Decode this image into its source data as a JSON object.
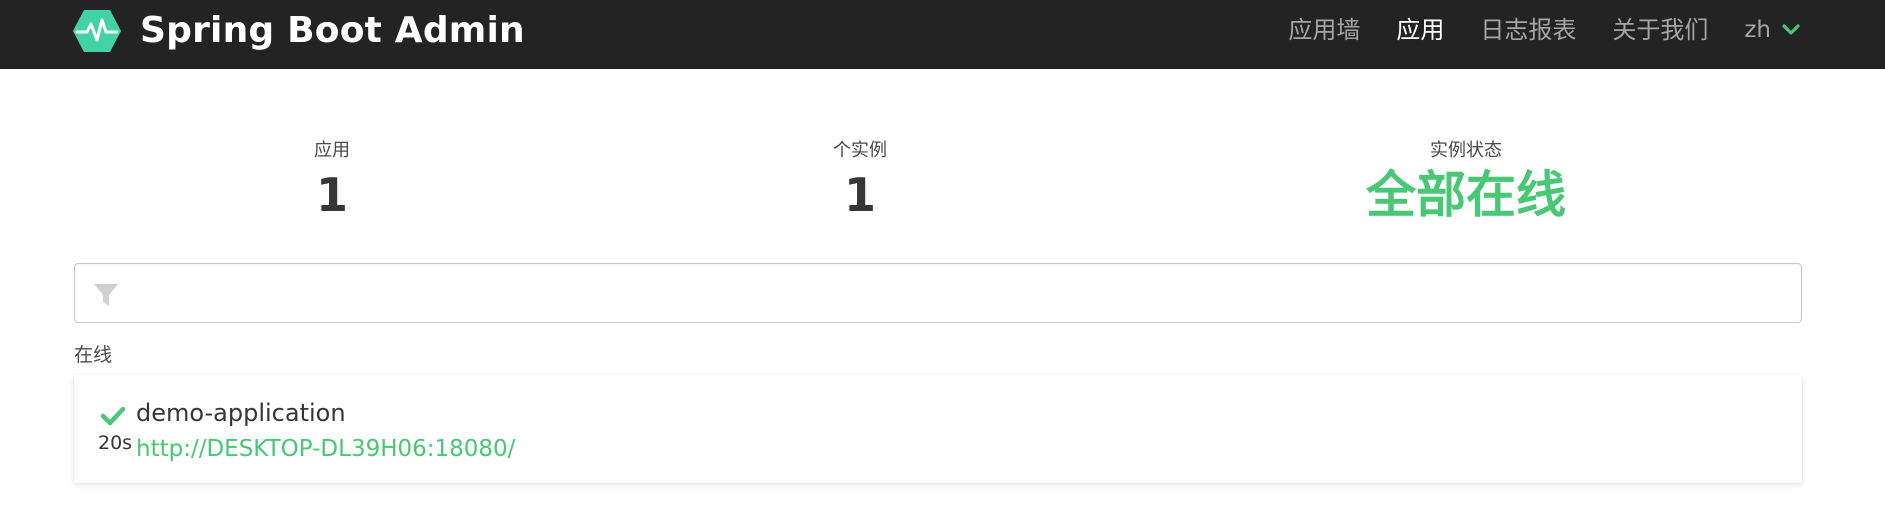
{
  "navbar": {
    "brand_title": "Spring Boot Admin",
    "brand_icon": "heartbeat-hexagon-icon",
    "items": [
      {
        "label": "应用墙",
        "active": false
      },
      {
        "label": "应用",
        "active": true
      },
      {
        "label": "日志报表",
        "active": false
      },
      {
        "label": "关于我们",
        "active": false
      }
    ],
    "language": {
      "label": "zh",
      "icon": "chevron-down-icon"
    }
  },
  "summary": {
    "applications": {
      "label": "应用",
      "value": "1"
    },
    "instances": {
      "label": "个实例",
      "value": "1"
    },
    "status": {
      "label": "实例状态",
      "value": "全部在线",
      "color": "#48c774"
    }
  },
  "filter": {
    "icon": "filter-icon",
    "value": "",
    "placeholder": ""
  },
  "groups": [
    {
      "title": "在线",
      "applications": [
        {
          "name": "demo-application",
          "status_icon": "check-icon",
          "age": "20s",
          "url": "http://DESKTOP-DL39H06:18080/"
        }
      ]
    }
  ],
  "colors": {
    "navbar_bg": "#232323",
    "accent_green": "#48c774",
    "brand_teal": "#42d3a5"
  }
}
